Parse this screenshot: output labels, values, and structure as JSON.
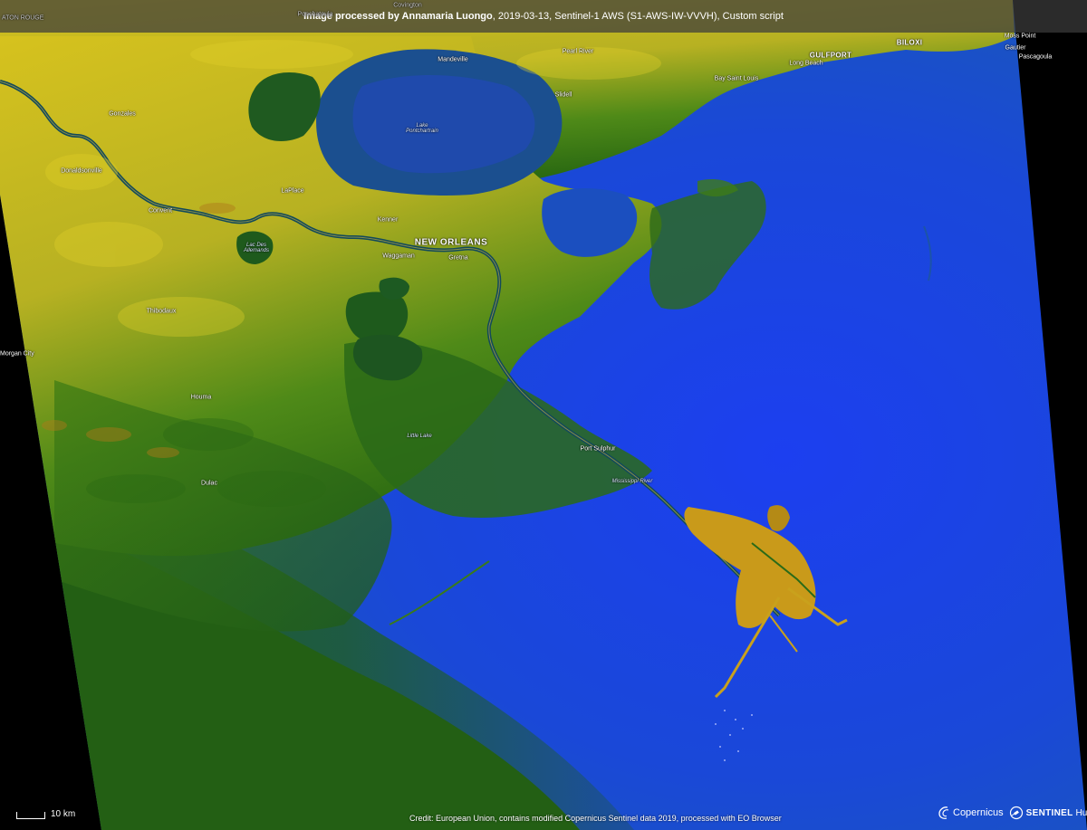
{
  "header": {
    "processed_by": "Image processed by Annamaria Luongo",
    "details": ", 2019-03-13, Sentinel-1 AWS (S1-AWS-IW-VVVH), Custom script"
  },
  "places": {
    "baton_rouge": "ATON ROUGE",
    "covington": "Covington",
    "ponchatoula": "Ponchatoula",
    "moss_point": "Moss Point",
    "mandeville": "Mandeville",
    "pearl_river": "Pearl River",
    "gulfport": "GULFPORT",
    "biloxi": "BILOXI",
    "gautier": "Gautier",
    "pascagoula": "Pascagoula",
    "long_beach": "Long Beach",
    "bay_saint_louis": "Bay Saint Louis",
    "slidell": "Slidell",
    "gonzales": "Gonzales",
    "lake_pontchartrain": "Lake\nPontchartrain",
    "donaldsonville": "Donaldsonville",
    "laplace": "LaPlace",
    "convent": "Convent",
    "kenner": "Kenner",
    "new_orleans": "NEW ORLEANS",
    "lac_des_allemands": "Lac Des\nAllemands",
    "waggaman": "Waggaman",
    "gretna": "Gretna",
    "thibodaux": "Thibodaux",
    "morgan_city": "Morgan City",
    "houma": "Houma",
    "little_lake": "Little Lake",
    "port_sulphur": "Port Sulphur",
    "mississippi_river": "Mississippi River",
    "dulac": "Dulac"
  },
  "scale": {
    "label": "10 km"
  },
  "credit": "Credit: European Union, contains modified Copernicus Sentinel data 2019, processed with EO Browser",
  "logos": {
    "copernicus": "Copernicus",
    "sentinel_bold": "SENTINEL",
    "sentinel_light": "Hub"
  },
  "colors": {
    "land_yellow": "#d9c622",
    "land_green": "#2f6e12",
    "water_deep": "#1a4fd0",
    "water_bright": "#1737f2",
    "nodata": "#000000"
  }
}
